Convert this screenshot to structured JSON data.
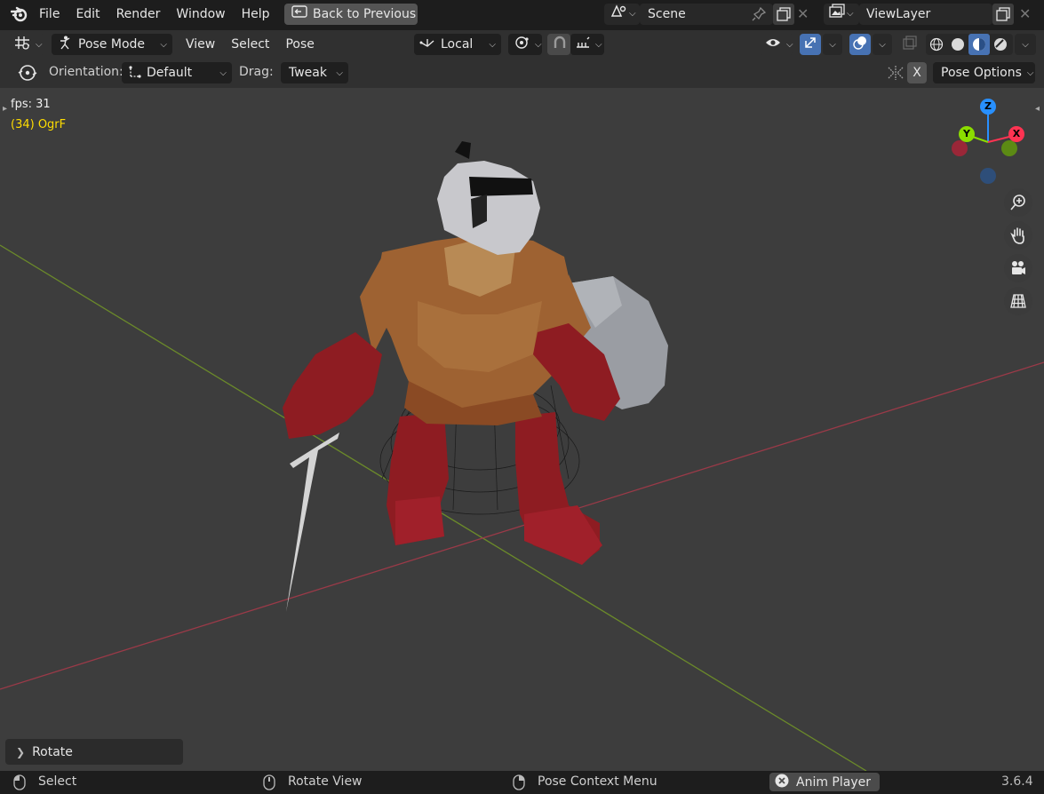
{
  "topbar": {
    "menus": [
      "File",
      "Edit",
      "Render",
      "Window",
      "Help"
    ],
    "back_button": "Back to Previous",
    "scene_name": "Scene",
    "view_layer": "ViewLayer"
  },
  "header": {
    "mode": "Pose Mode",
    "menus": [
      "View",
      "Select",
      "Pose"
    ],
    "transform_orientation": "Local"
  },
  "tool_settings": {
    "orientation_label": "Orientation:",
    "orientation_value": "Default",
    "drag_label": "Drag:",
    "drag_value": "Tweak",
    "x_mirror": "X",
    "pose_options": "Pose Options"
  },
  "viewport": {
    "fps": "fps: 31",
    "object_info": "(34) OgrF",
    "gizmo_axes": {
      "z": "Z",
      "y": "Y",
      "x": "X"
    },
    "operator_panel": "Rotate",
    "nav_icons": [
      "zoom-icon",
      "hand-pan-icon",
      "camera-icon",
      "grid-perspective-icon"
    ]
  },
  "statusbar": {
    "select": "Select",
    "rotate_view": "Rotate View",
    "context_menu": "Pose Context Menu",
    "anim_player": "Anim Player",
    "version": "3.6.4"
  },
  "colors": {
    "accent_blue": "#4772b3",
    "axis_x": "#ff3352",
    "axis_y": "#8bdc00",
    "axis_z": "#2890ff",
    "info_yellow": "#ffdd00"
  }
}
